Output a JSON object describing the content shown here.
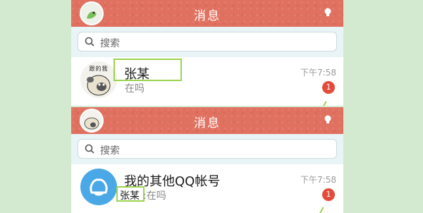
{
  "top_panel": {
    "header": {
      "title": "消息"
    },
    "search": {
      "placeholder": "搜索"
    },
    "conversation": {
      "name": "张某",
      "message": "在吗",
      "time": "下午7:58",
      "unread": "1",
      "avatar_caption": "跟的我"
    }
  },
  "bottom_panel": {
    "header": {
      "title": "消息"
    },
    "search": {
      "placeholder": "搜索"
    },
    "conversation": {
      "name": "我的其他QQ帐号",
      "sender": "张某",
      "message": ":在吗",
      "time": "下午7:58",
      "unread": "1"
    }
  },
  "colors": {
    "header": "#e0705f",
    "highlight": "#9bd34f",
    "badge": "#e34c3c",
    "qq_blue": "#4aa8e6",
    "background": "#d3ead0"
  },
  "icons": {
    "header_avatar": "avatar-icon",
    "right_action": "lightbulb-icon",
    "search": "search-icon",
    "qq_logo": "qq-logo-icon"
  }
}
